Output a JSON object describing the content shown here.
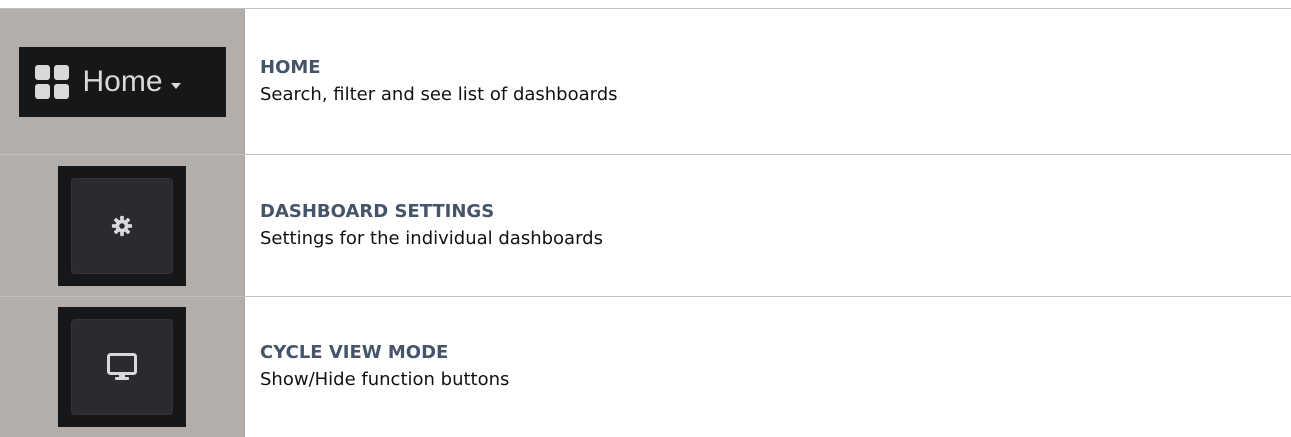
{
  "rows": [
    {
      "icon": "home-dashboard-grid-icon",
      "button_label": "Home",
      "title": "HOME",
      "description": "Search, filter and see list of dashboards"
    },
    {
      "icon": "gear-icon",
      "title": "DASHBOARD SETTINGS",
      "description": "Settings for the individual dashboards"
    },
    {
      "icon": "monitor-icon",
      "title": "CYCLE VIEW MODE",
      "description": "Show/Hide function buttons"
    }
  ],
  "colors": {
    "title": "#44546a",
    "icon_cell_bg": "#b3aeaa",
    "button_bg": "#161719",
    "icon_fg": "#d8d9da"
  }
}
